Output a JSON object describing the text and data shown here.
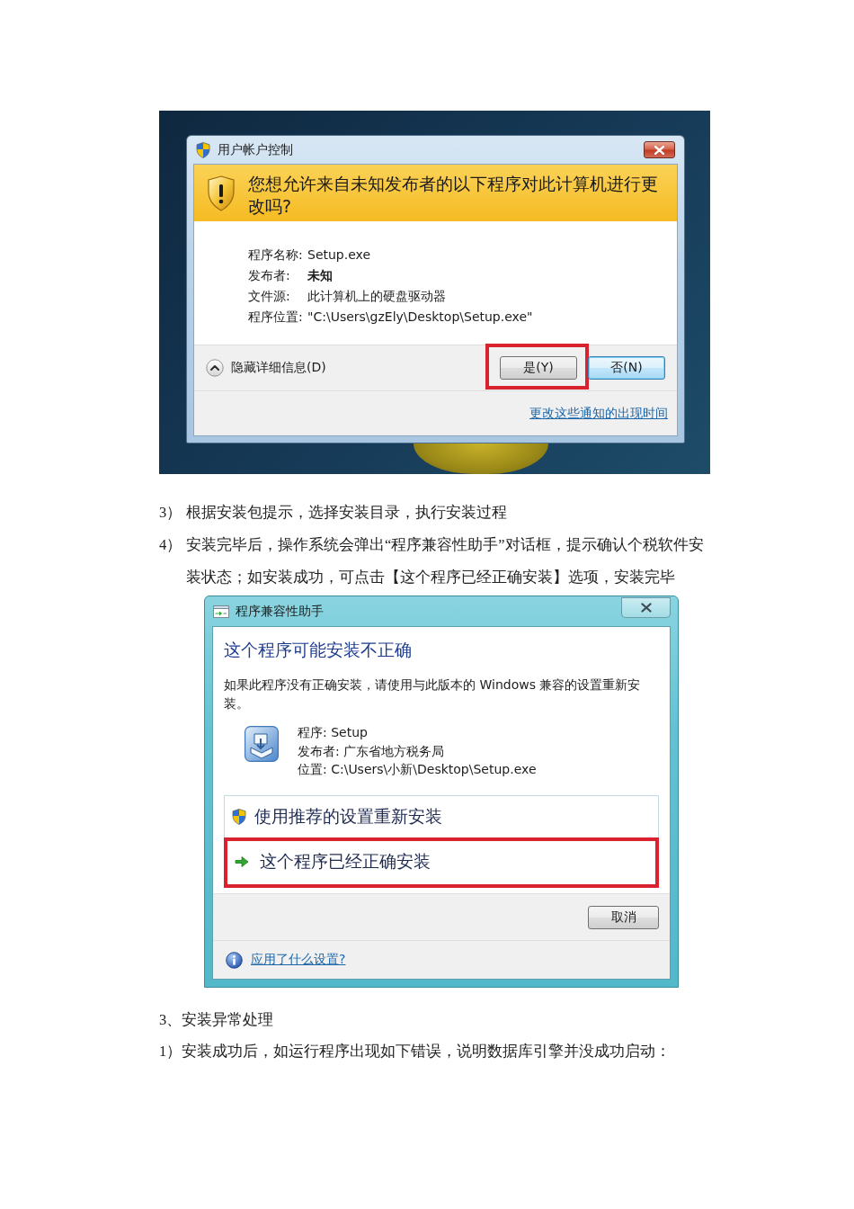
{
  "uac_screenshot": {
    "window": {
      "title": "用户帐户控制"
    },
    "prompt": "您想允许来自未知发布者的以下程序对此计算机进行更改吗?",
    "details": [
      {
        "label": "程序名称:",
        "value": "Setup.exe",
        "emphasized": false
      },
      {
        "label": "发布者:",
        "value": "未知",
        "emphasized": true
      },
      {
        "label": "文件源:",
        "value": "此计算机上的硬盘驱动器",
        "emphasized": false
      },
      {
        "label": "程序位置:",
        "value": "\"C:\\Users\\gzEly\\Desktop\\Setup.exe\"",
        "emphasized": false
      }
    ],
    "details_toggle": {
      "label": "隐藏详细信息(D)",
      "expanded": true
    },
    "buttons": [
      {
        "label": "是(Y)",
        "default": false,
        "highlighted": true
      },
      {
        "label": "否(N)",
        "default": true,
        "highlighted": false
      }
    ],
    "link": "更改这些通知的出现时间"
  },
  "steps": [
    {
      "number": "3）",
      "text": "根据安装包提示，选择安装目录，执行安装过程"
    },
    {
      "number": "4）",
      "text": "安装完毕后，操作系统会弹出“程序兼容性助手”对话框，提示确认个税软件安装状态；如安装成功，可点击【这个程序已经正确安装】选项，安装完毕"
    }
  ],
  "compat_screenshot": {
    "window": {
      "title": "程序兼容性助手"
    },
    "heading": "这个程序可能安装不正确",
    "message": "如果此程序没有正确安装，请使用与此版本的 Windows 兼容的设置重新安装。",
    "program": [
      "程序: Setup",
      "发布者: 广东省地方税务局",
      "位置: C:\\Users\\小新\\Desktop\\Setup.exe"
    ],
    "options": [
      {
        "kind": "shield",
        "label": "使用推荐的设置重新安装",
        "highlighted": false
      },
      {
        "kind": "arrow",
        "label": "这个程序已经正确安装",
        "highlighted": true
      }
    ],
    "buttons": [
      {
        "label": "取消"
      }
    ],
    "help_link": "应用了什么设置?"
  },
  "section": {
    "heading": "3、安装异常处理",
    "paragraphs": [
      "1）安装成功后，如运行程序出现如下错误，说明数据库引擎并没成功启动："
    ]
  }
}
